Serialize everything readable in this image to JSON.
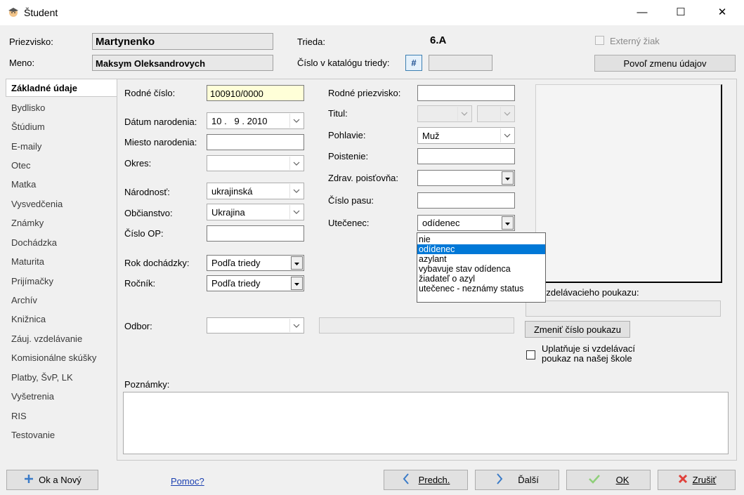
{
  "window": {
    "title": "Študent",
    "minimize": "—",
    "maximize": "☐",
    "close": "✕"
  },
  "header": {
    "surname_label": "Priezvisko:",
    "surname": "Martynenko",
    "name_label": "Meno:",
    "name": "Maksym Oleksandrovych",
    "class_label": "Trieda:",
    "class_value": "6.A",
    "catalog_label": "Číslo v katalógu triedy:",
    "catalog_button": "#",
    "catalog_value": "",
    "external_label": "Externý žiak",
    "allow_change_button": "Povoľ zmenu údajov"
  },
  "sidebar": {
    "items": [
      {
        "label": "Základné údaje",
        "active": true
      },
      {
        "label": "Bydlisko"
      },
      {
        "label": "Štúdium"
      },
      {
        "label": "E-maily"
      },
      {
        "label": "Otec"
      },
      {
        "label": "Matka"
      },
      {
        "label": "Vysvedčenia"
      },
      {
        "label": "Známky"
      },
      {
        "label": "Dochádzka"
      },
      {
        "label": "Maturita"
      },
      {
        "label": "Prijímačky"
      },
      {
        "label": "Archív"
      },
      {
        "label": "Knižnica"
      },
      {
        "label": "Záuj. vzdelávanie"
      },
      {
        "label": "Komisionálne skúšky"
      },
      {
        "label": "Platby, ŠvP, LK"
      },
      {
        "label": "Vyšetrenia"
      },
      {
        "label": "RIS"
      },
      {
        "label": "Testovanie"
      }
    ]
  },
  "form": {
    "birth_number_label": "Rodné číslo:",
    "birth_number": "100910/0000",
    "birth_date_label": "Dátum narodenia:",
    "birth_date": "10 .   9 . 2010",
    "birth_place_label": "Miesto narodenia:",
    "birth_place": "",
    "district_label": "Okres:",
    "district": "",
    "nationality_label": "Národnosť:",
    "nationality": "ukrajinská",
    "citizenship_label": "Občianstvo:",
    "citizenship": "Ukrajina",
    "id_card_label": "Číslo OP:",
    "id_card": "",
    "attendance_year_label": "Rok dochádzky:",
    "attendance_year": "Podľa triedy",
    "grade_label": "Ročník:",
    "grade": "Podľa triedy",
    "field_label": "Odbor:",
    "field": "",
    "field_text": "",
    "maiden_name_label": "Rodné priezvisko:",
    "maiden_name": "",
    "title_label": "Titul:",
    "gender_label": "Pohlavie:",
    "gender": "Muž",
    "insurance_label": "Poistenie:",
    "insurance": "",
    "health_ins_label": "Zdrav. poisťovňa:",
    "health_ins": "",
    "passport_label": "Číslo pasu:",
    "passport": "",
    "refugee_label": "Utečenec:",
    "refugee": "odídenec",
    "refugee_options": [
      "nie",
      "odídenec",
      "azylant",
      "vybavuje stav odídenca",
      "žiadateľ o azyl",
      "utečenec - neznámy status"
    ],
    "refugee_selected_index": 1,
    "voucher_label": "o vzdelávacieho poukazu:",
    "voucher_value": "",
    "change_voucher_button": "Zmeniť číslo poukazu",
    "voucher_check_label_1": "Uplatňuje si vzdelávací",
    "voucher_check_label_2": "poukaz na našej škole",
    "notes_label": "Poznámky:",
    "notes": ""
  },
  "footer": {
    "ok_new": "Ok a Nový",
    "help": "Pomoc?",
    "prev": "Predch.",
    "next": "Ďalší",
    "ok": "OK",
    "cancel": "Zrušiť"
  }
}
